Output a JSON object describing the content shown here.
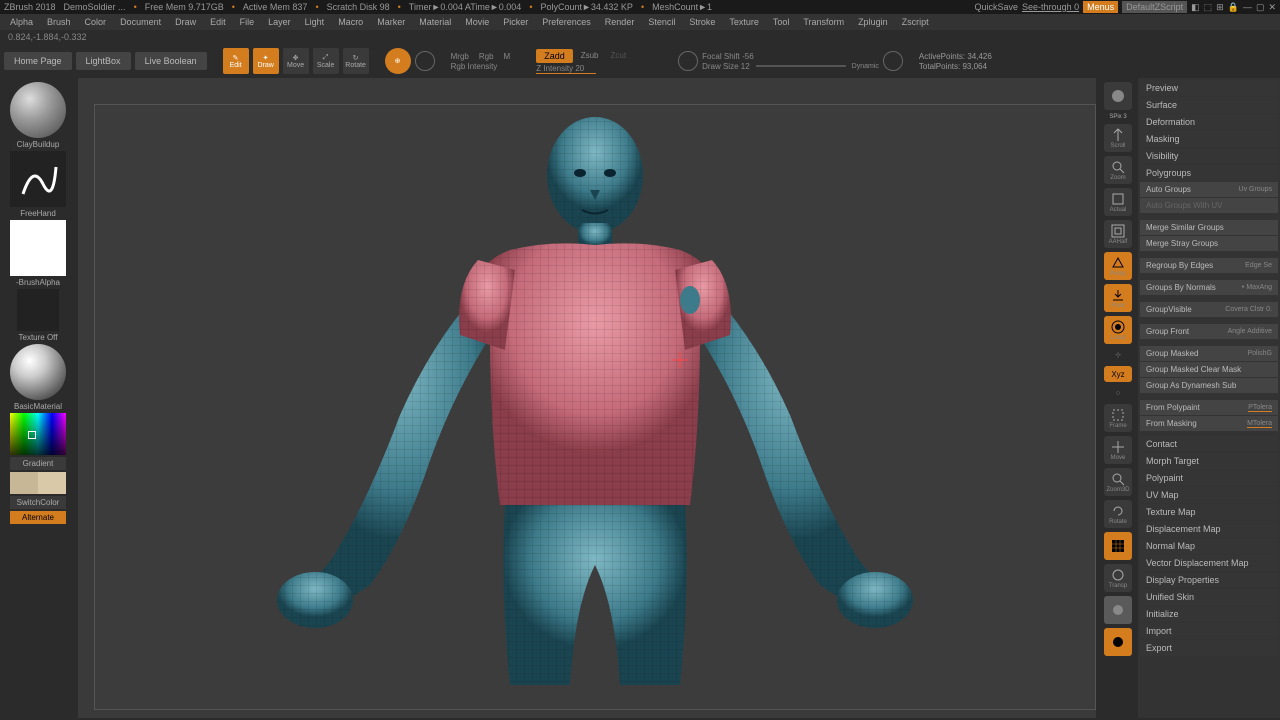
{
  "topbar": {
    "app": "ZBrush 2018",
    "project": "DemoSoldier ...",
    "freemem": "Free Mem 9.717GB",
    "activemem": "Active Mem 837",
    "scratch": "Scratch Disk 98",
    "timer": "Timer►0.004 ATime►0.004",
    "poly": "PolyCount►34.432 KP",
    "mesh": "MeshCount►1",
    "quicksave": "QuickSave",
    "seethrough": "See-through  0",
    "menus": "Menus",
    "defscript": "DefaultZScript"
  },
  "menu": [
    "Alpha",
    "Brush",
    "Color",
    "Document",
    "Draw",
    "Edit",
    "File",
    "Layer",
    "Light",
    "Macro",
    "Marker",
    "Material",
    "Movie",
    "Picker",
    "Preferences",
    "Render",
    "Stencil",
    "Stroke",
    "Texture",
    "Tool",
    "Transform",
    "Zplugin",
    "Zscript"
  ],
  "coords": "0.824,-1.884,-0.332",
  "toolbar": {
    "home": "Home Page",
    "lightbox": "LightBox",
    "liveboolean": "Live Boolean",
    "edit": "Edit",
    "draw": "Draw",
    "move": "Move",
    "scale": "Scale",
    "rotate": "Rotate",
    "mrgb": "Mrgb",
    "rgb": "Rgb",
    "m": "M",
    "rgbint": "Rgb Intensity",
    "zadd": "Zadd",
    "zsub": "Zsub",
    "zcut": "Zcut",
    "zint": "Z Intensity 20",
    "focal": "Focal Shift -56",
    "drawsize": "Draw Size 12",
    "dynamic": "Dynamic",
    "active": "ActivePoints: 34,426",
    "total": "TotalPoints: 93,064"
  },
  "left": {
    "brush": "ClayBuildup",
    "stroke": "FreeHand",
    "alpha": "-BrushAlpha",
    "texture": "Texture Off",
    "material": "BasicMaterial",
    "gradient": "Gradient",
    "switch": "SwitchColor",
    "alternate": "Alternate"
  },
  "righttools": {
    "spix": "SPix 3"
  },
  "panel": {
    "sections": [
      "Preview",
      "Surface",
      "Deformation",
      "Masking",
      "Visibility",
      "Polygroups"
    ],
    "polygroups": {
      "autogroups": "Auto Groups",
      "uvgroups": "Uv Groups",
      "autouv": "Auto Groups With UV",
      "mergesim": "Merge Similar Groups",
      "mergestray": "Merge Stray Groups",
      "regroup": "Regroup By Edges",
      "edgesel": "Edge Se",
      "normals": "Groups By Normals",
      "maxang": "MaxAng",
      "groupvis": "GroupVisible",
      "coverage": "Covera",
      "clstr": "Clstr 0.",
      "groupfront": "Group Front",
      "angle": "Angle",
      "additive": "Additive",
      "groupmasked": "Group Masked",
      "polishg": "PolishG",
      "clearmask": "Group Masked Clear Mask",
      "dynamesh": "Group As Dynamesh Sub",
      "polypaint": "From Polypaint",
      "ptol": "PTolera",
      "masking": "From Masking",
      "mtol": "MTolera"
    },
    "bottom": [
      "Contact",
      "Morph Target",
      "Polypaint",
      "UV Map",
      "Texture Map",
      "Displacement Map",
      "Normal Map",
      "Vector Displacement Map",
      "Display Properties",
      "Unified Skin",
      "Initialize",
      "Import",
      "Export"
    ]
  }
}
